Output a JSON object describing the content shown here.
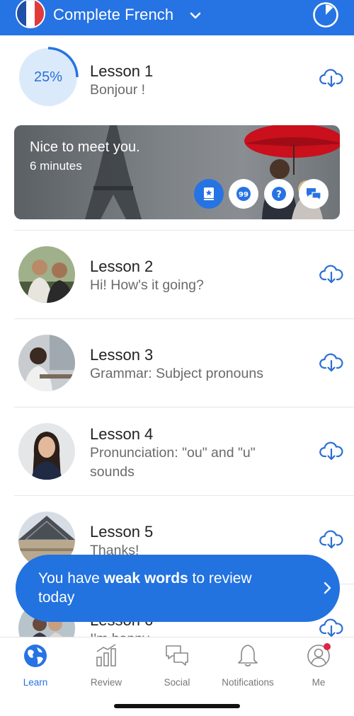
{
  "header": {
    "course_title": "Complete French",
    "flag_icon": "france-flag-icon",
    "colors": {
      "bar": "#2673e3"
    }
  },
  "lessons": [
    {
      "title": "Lesson 1",
      "subtitle": "Bonjour !",
      "progress_label": "25%",
      "progress": 0.25
    },
    {
      "title": "Lesson 2",
      "subtitle": "Hi! How's it going?"
    },
    {
      "title": "Lesson 3",
      "subtitle": "Grammar: Subject pronouns"
    },
    {
      "title": "Lesson 4",
      "subtitle": "Pronunciation: \"ou\" and \"u\" sounds"
    },
    {
      "title": "Lesson 5",
      "subtitle": "Thanks!"
    },
    {
      "title": "Lesson 6",
      "subtitle": "I'm happy"
    }
  ],
  "activity_card": {
    "title": "Nice to meet you.",
    "duration": "6 minutes",
    "activity_icons": [
      "vocabulary-card-icon",
      "quote-icon",
      "question-icon",
      "conversation-icon"
    ]
  },
  "weak_words_banner": {
    "text_before": "You have ",
    "text_bold": "weak words",
    "text_after": " to review today"
  },
  "nav": {
    "items": [
      {
        "label": "Learn",
        "icon": "globe-icon",
        "active": true
      },
      {
        "label": "Review",
        "icon": "bar-chart-icon"
      },
      {
        "label": "Social",
        "icon": "chat-bubbles-icon"
      },
      {
        "label": "Notifications",
        "icon": "bell-icon"
      },
      {
        "label": "Me",
        "icon": "profile-icon",
        "has_badge": true
      }
    ],
    "colors": {
      "active": "#2673e3",
      "inactive": "#777777",
      "badge": "#e0244a"
    }
  }
}
